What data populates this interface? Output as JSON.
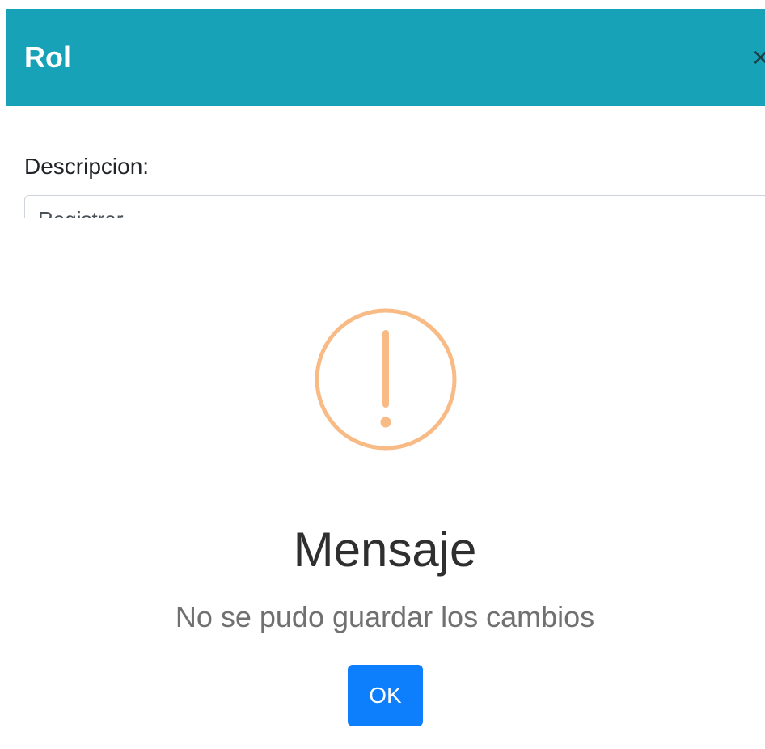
{
  "modal": {
    "title": "Rol",
    "close_symbol": "×",
    "field": {
      "label": "Descripcion:",
      "value": "Registrar"
    }
  },
  "alert": {
    "icon": "warning-exclamation-icon",
    "icon_color": "#f8bb86",
    "title": "Mensaje",
    "text": "No se pudo guardar los cambios",
    "confirm_label": "OK",
    "confirm_color": "#0d7efc"
  },
  "colors": {
    "header_background": "#17a2b8"
  }
}
